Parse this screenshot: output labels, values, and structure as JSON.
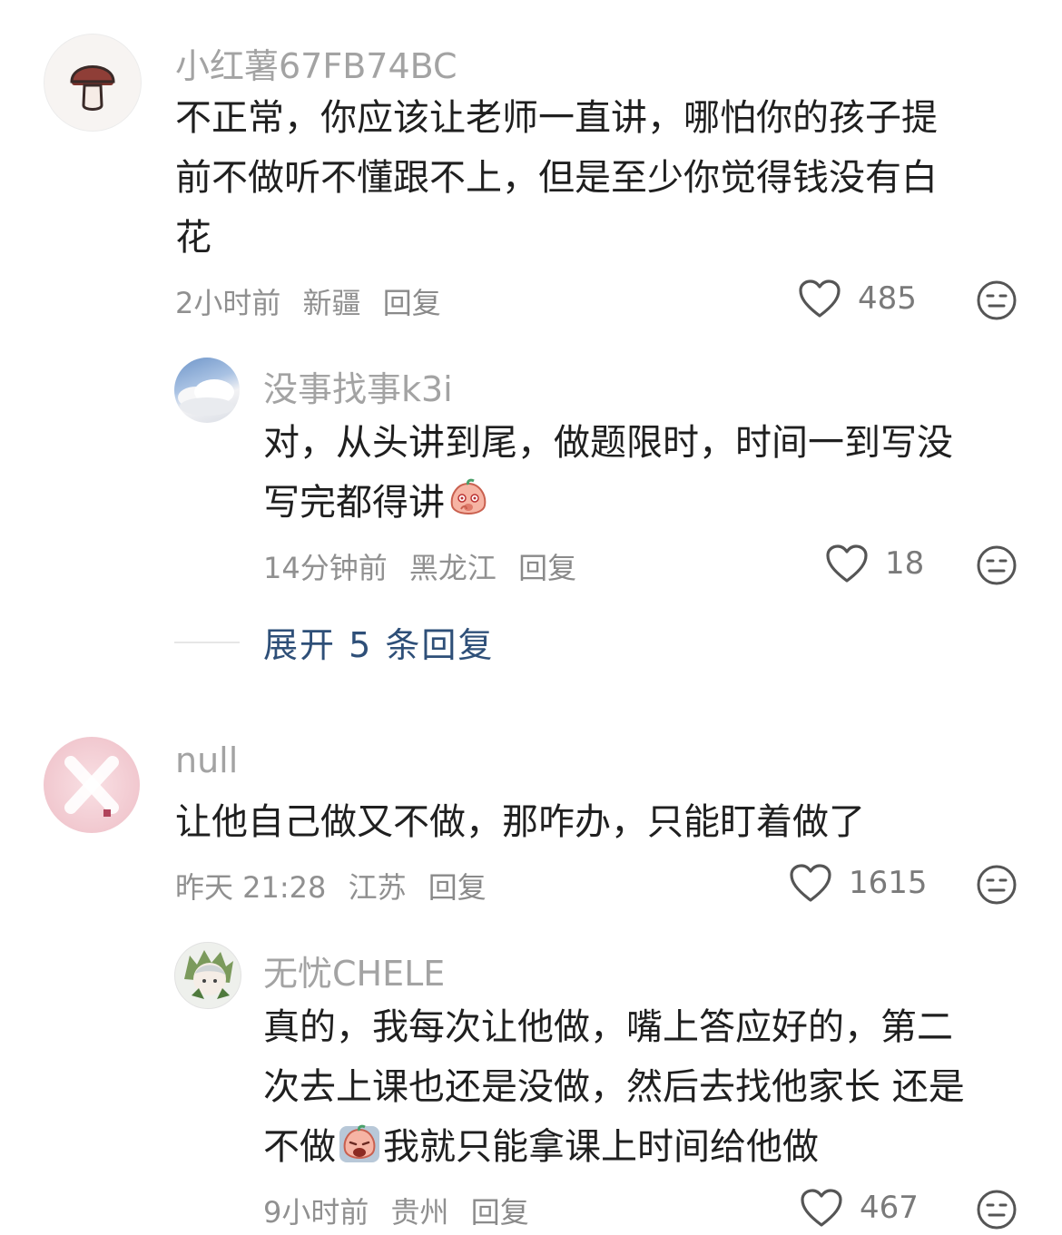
{
  "comments": [
    {
      "username": "小红薯67FB74BC",
      "avatar_icon": "mushroom-icon",
      "lines": [
        "不正常，你应该让老师一直讲，哪怕你的孩子提",
        "前不做听不懂跟不上，但是至少你觉得钱没有白",
        "花"
      ],
      "time": "2小时前",
      "location": "新疆",
      "reply_label": "回复",
      "likes": "485",
      "replies": [
        {
          "username": "没事找事k3i",
          "avatar_icon": "cloud-avatar",
          "line1": "对，从头讲到尾，做题限时，时间一到写没",
          "line2": "写完都得讲",
          "emoji": "shy-peach-emoji",
          "time": "14分钟前",
          "location": "黑龙江",
          "reply_label": "回复",
          "likes": "18"
        }
      ],
      "expand_label": "展开 5 条回复"
    },
    {
      "username": "null",
      "avatar_icon": "pink-x-avatar",
      "lines": [
        "让他自己做又不做，那咋办，只能盯着做了"
      ],
      "time": "昨天 21:28",
      "location": "江苏",
      "reply_label": "回复",
      "likes": "1615",
      "replies": [
        {
          "username": "无忧CHELE",
          "avatar_icon": "anime-avatar",
          "line1": "真的，我每次让他做，嘴上答应好的，第二",
          "line2": "次去上课也还是没做，然后去找他家长 还是",
          "line3_before": "不做",
          "emoji": "crying-peach-emoji",
          "line3_after": "我就只能拿课上时间给他做",
          "time": "9小时前",
          "location": "贵州",
          "reply_label": "回复",
          "likes": "467"
        }
      ]
    }
  ],
  "colors": {
    "username": "#a3a3a3",
    "body_text": "#1f1f1f",
    "meta": "#909090",
    "expand_link": "#2e4f78"
  }
}
